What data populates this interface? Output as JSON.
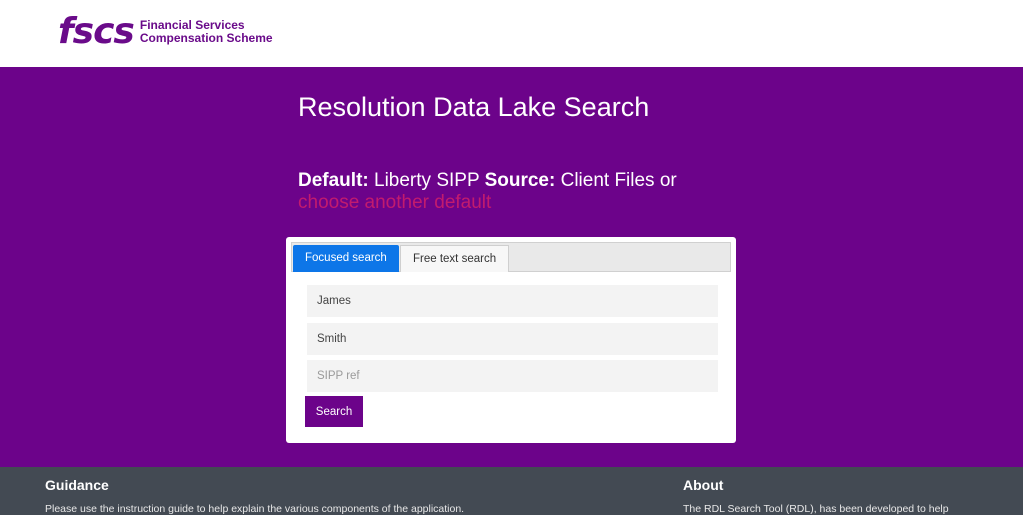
{
  "header": {
    "logo_mark": "fscs",
    "logo_line1": "Financial Services",
    "logo_line2": "Compensation Scheme"
  },
  "hero": {
    "title": "Resolution Data Lake Search",
    "default_label": "Default:",
    "default_value": " Liberty SIPP ",
    "source_label": "Source:",
    "source_value": "  Client Files  or",
    "choose_link": "choose another default"
  },
  "search": {
    "tabs": [
      {
        "label": "Focused search",
        "active": true
      },
      {
        "label": "Free text search",
        "active": false
      }
    ],
    "first_name": {
      "value": "James",
      "placeholder": ""
    },
    "last_name": {
      "value": "Smith",
      "placeholder": ""
    },
    "sipp_ref": {
      "value": "",
      "placeholder": "SIPP ref"
    },
    "button_label": "Search"
  },
  "footer": {
    "guidance_title": "Guidance",
    "guidance_text": "Please use the instruction guide to help explain the various components of the application.",
    "about_title": "About",
    "about_text": "The RDL Search Tool (RDL), has been developed to help"
  },
  "colors": {
    "brand_purple": "#6c038a",
    "tab_blue": "#0d76e8",
    "link_pink": "#c21b6e",
    "footer_bg": "#434a53"
  }
}
